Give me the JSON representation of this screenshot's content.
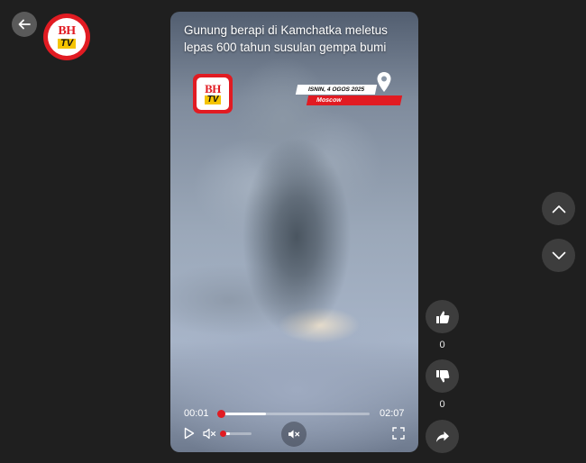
{
  "channel": {
    "logo_top": "BH",
    "logo_bottom": "TV"
  },
  "video": {
    "title": "Gunung berapi di Kamchatka meletus lepas 600 tahun susulan gempa bumi",
    "overlay_logo_top": "BH",
    "overlay_logo_bottom": "TV",
    "date": "ISNIN, 4 OGOS 2025",
    "location": "Moscow"
  },
  "player": {
    "current_time": "00:01",
    "total_time": "02:07",
    "progress_percent": 30,
    "knob_percent": 0,
    "volume_percent": 25,
    "accent_color": "#e11b22"
  },
  "actions": {
    "like_count": "0",
    "dislike_count": "0"
  },
  "icons": [
    "back-arrow-icon",
    "location-pin-icon",
    "play-icon",
    "mute-icon",
    "fullscreen-icon",
    "chevron-up-icon",
    "chevron-down-icon",
    "thumbs-up-icon",
    "thumbs-down-icon",
    "share-icon"
  ]
}
